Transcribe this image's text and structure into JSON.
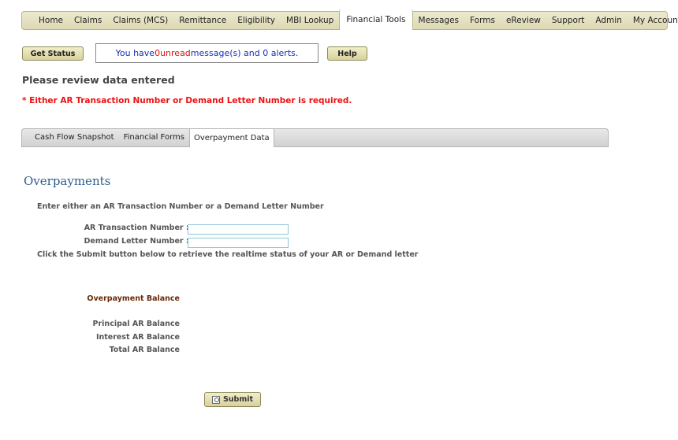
{
  "nav": {
    "items": [
      {
        "label": "Home"
      },
      {
        "label": "Claims"
      },
      {
        "label": "Claims (MCS)"
      },
      {
        "label": "Remittance"
      },
      {
        "label": "Eligibility"
      },
      {
        "label": "MBI Lookup"
      },
      {
        "label": "Financial Tools",
        "active": true
      },
      {
        "label": "Messages"
      },
      {
        "label": "Forms"
      },
      {
        "label": "eReview"
      },
      {
        "label": "Support"
      },
      {
        "label": "Admin"
      },
      {
        "label": "My Account"
      }
    ]
  },
  "toolbar": {
    "get_status": "Get Status",
    "help": "Help",
    "message": {
      "prefix": "You have ",
      "unread_count": "0",
      "unread_word": " unread",
      "suffix": " message(s) and 0 alerts."
    }
  },
  "review": {
    "heading": "Please review data entered",
    "error": "* Either AR Transaction Number or Demand Letter Number is required."
  },
  "subtabs": [
    {
      "label": "Cash Flow Snapshot"
    },
    {
      "label": "Financial Forms"
    },
    {
      "label": "Overpayment Data",
      "active": true
    }
  ],
  "overpayments": {
    "title": "Overpayments",
    "instruction": "Enter either an AR Transaction Number or a Demand Letter Number",
    "ar_label": "AR Transaction Number : *",
    "ar_value": "",
    "dl_label": "Demand Letter Number : *",
    "dl_value": "",
    "click_instruction": "Click the Submit button below to retrieve the realtime status of your AR or Demand letter",
    "balance_heading": "Overpayment Balance",
    "principal_label": "Principal AR Balance",
    "interest_label": "Interest AR Balance",
    "total_label": "Total AR Balance",
    "submit": "Submit"
  },
  "colors": {
    "nav_bg": "#ddd9b3",
    "error": "#ee1111",
    "message_text": "#1a2fb8",
    "title_blue": "#2e5e8e",
    "balance_heading": "#6b2a0a"
  }
}
